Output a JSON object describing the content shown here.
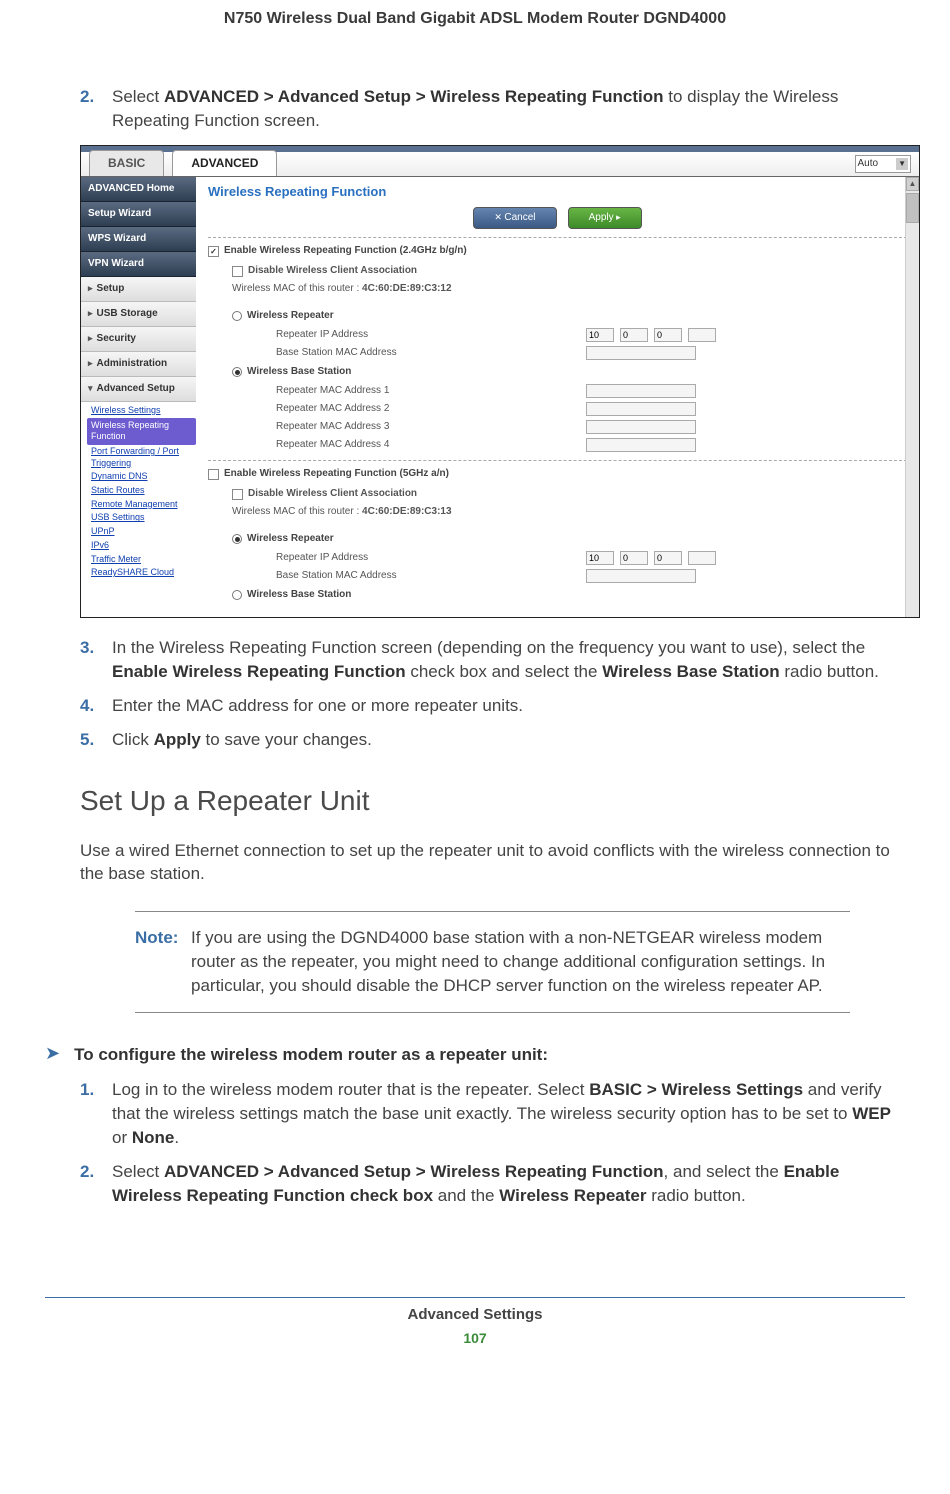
{
  "header": {
    "title": "N750 Wireless Dual Band Gigabit ADSL Modem Router DGND4000"
  },
  "steps_a": [
    {
      "num": "2.",
      "prefix": "Select ",
      "bold": "ADVANCED > Advanced Setup > Wireless Repeating Function",
      "suffix": " to display the Wireless Repeating Function screen."
    },
    {
      "num": "3.",
      "text_parts": [
        "In the Wireless Repeating Function screen (depending on the frequency you want to use), select the ",
        "Enable Wireless Repeating Function",
        " check box and select the ",
        "Wireless Base Station",
        " radio button."
      ]
    },
    {
      "num": "4.",
      "text": "Enter the MAC address for one or more repeater units."
    },
    {
      "num": "5.",
      "text_parts": [
        "Click ",
        "Apply",
        " to save your changes."
      ]
    }
  ],
  "screenshot": {
    "tab_basic": "BASIC",
    "tab_advanced": "ADVANCED",
    "auto": "Auto",
    "sidebar": {
      "dark": [
        "ADVANCED Home",
        "Setup Wizard",
        "WPS Wizard",
        "VPN Wizard"
      ],
      "light": [
        "Setup",
        "USB Storage",
        "Security",
        "Administration"
      ],
      "expanded": "Advanced Setup",
      "sublinks": [
        "Wireless Settings",
        "Wireless Repeating Function",
        "Port Forwarding / Port Triggering",
        "Dynamic DNS",
        "Static Routes",
        "Remote Management",
        "USB Settings",
        "UPnP",
        "IPv6",
        "Traffic Meter",
        "ReadySHARE Cloud"
      ]
    },
    "main": {
      "title": "Wireless Repeating Function",
      "cancel": "Cancel",
      "apply": "Apply",
      "section24": {
        "enable": "Enable Wireless Repeating Function (2.4GHz b/g/n)",
        "disable_assoc": "Disable Wireless Client Association",
        "mac_label": "Wireless MAC of this router :",
        "mac_value": "4C:60:DE:89:C3:12",
        "repeater": "Wireless Repeater",
        "rep_ip": "Repeater IP Address",
        "base_mac": "Base Station MAC Address",
        "base": "Wireless Base Station",
        "mac1": "Repeater MAC Address 1",
        "mac2": "Repeater MAC Address 2",
        "mac3": "Repeater MAC Address 3",
        "mac4": "Repeater MAC Address 4",
        "ip": [
          "10",
          "0",
          "0",
          ""
        ]
      },
      "section5": {
        "enable": "Enable Wireless Repeating Function (5GHz a/n)",
        "disable_assoc": "Disable Wireless Client Association",
        "mac_label": "Wireless MAC of this router :",
        "mac_value": "4C:60:DE:89:C3:13",
        "repeater": "Wireless Repeater",
        "rep_ip": "Repeater IP Address",
        "base_mac": "Base Station MAC Address",
        "base": "Wireless Base Station",
        "ip": [
          "10",
          "0",
          "0",
          ""
        ]
      }
    }
  },
  "heading2": "Set Up a Repeater Unit",
  "body2": "Use a wired Ethernet connection to set up the repeater unit to avoid conflicts with the wireless connection to the base station.",
  "note": {
    "label": "Note:",
    "text": "If you are using the DGND4000 base station with a non-NETGEAR wireless modem router as the repeater, you might need to change additional configuration settings. In particular, you should disable the DHCP server function on the wireless repeater AP."
  },
  "proc": {
    "title": "To configure the wireless modem router as a repeater unit:"
  },
  "steps_b": [
    {
      "num": "1.",
      "parts": [
        "Log in to the wireless modem router that is the repeater. Select ",
        "BASIC > Wireless Settings",
        " and verify that the wireless settings match the base unit exactly. The wireless security option has to be set to ",
        "WEP",
        " or ",
        "None",
        "."
      ]
    },
    {
      "num": "2.",
      "parts": [
        "Select ",
        "ADVANCED > Advanced Setup > Wireless Repeating Function",
        ", and select the ",
        "Enable Wireless Repeating Function check box",
        " and the ",
        "Wireless Repeater",
        " radio button."
      ]
    }
  ],
  "footer": {
    "section": "Advanced Settings",
    "page": "107"
  }
}
